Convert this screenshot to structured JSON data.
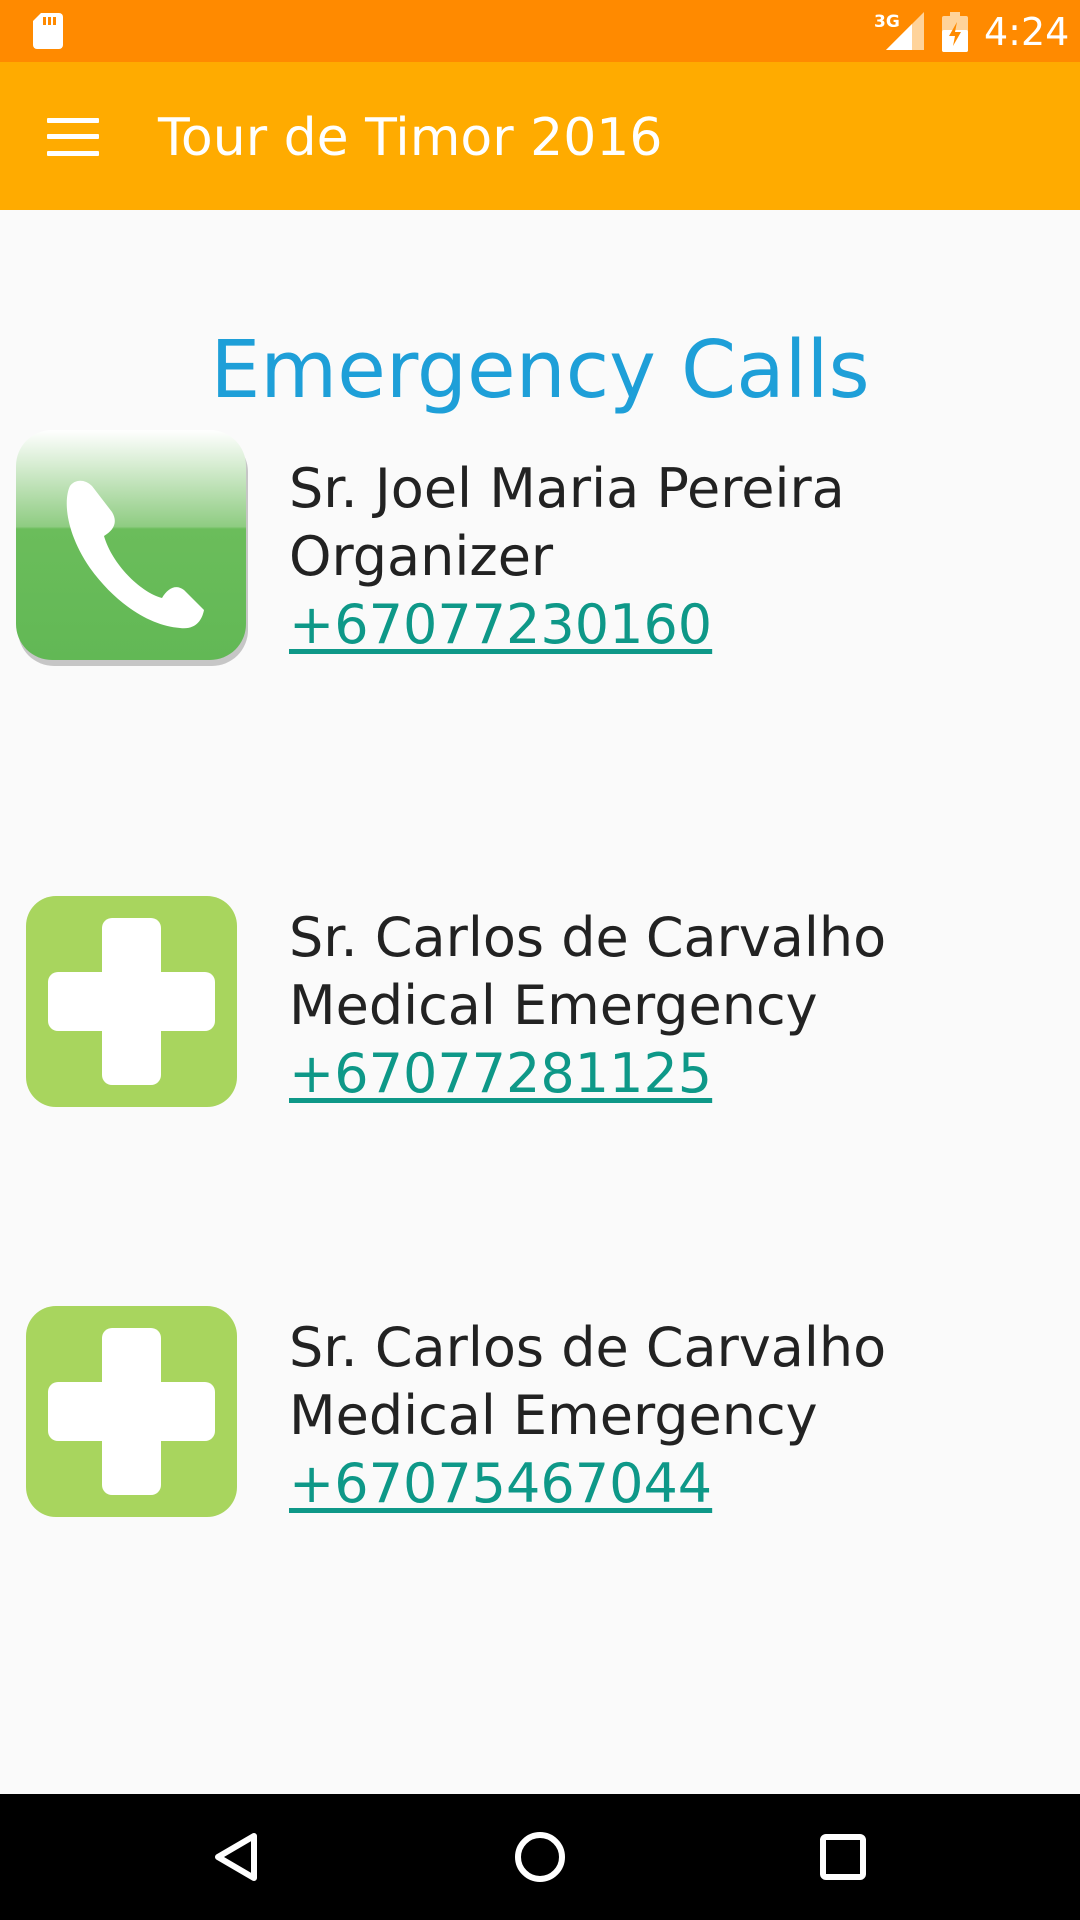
{
  "status_bar": {
    "network": "3G",
    "time": "4:24"
  },
  "toolbar": {
    "title": "Tour de Timor 2016",
    "menu_icon": "hamburger-menu-icon"
  },
  "page": {
    "title": "Emergency Calls"
  },
  "contacts": [
    {
      "icon": "phone-icon",
      "name": "Sr. Joel Maria Pereira",
      "role": "Organizer",
      "phone": "+67077230160"
    },
    {
      "icon": "medical-cross-icon",
      "name": "Sr. Carlos de Carvalho",
      "role": "Medical Emergency",
      "phone": "+67077281125"
    },
    {
      "icon": "medical-cross-icon",
      "name": "Sr. Carlos de Carvalho",
      "role": "Medical Emergency",
      "phone": "+67075467044"
    }
  ],
  "nav_bar": {
    "back": "back-triangle-icon",
    "home": "home-circle-icon",
    "recents": "recents-square-icon"
  },
  "colors": {
    "status_bar": "#ff8a00",
    "toolbar": "#ffab00",
    "title_blue": "#1e9fd8",
    "link_teal": "#0e9888",
    "phone_green": "#66bb55",
    "cross_green": "#a8d55e"
  }
}
